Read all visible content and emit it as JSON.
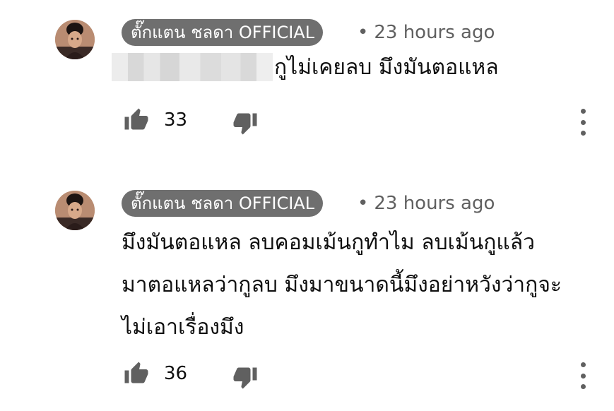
{
  "comments": [
    {
      "author": "ตั๊กแตน ชลดา OFFICIAL",
      "separator": "•",
      "time": "23 hours ago",
      "lines": [
        "กูไม่เคยลบ มึงมันตอแหล"
      ],
      "likes": "33",
      "has_redacted_mention": true
    },
    {
      "author": "ตั๊กแตน ชลดา OFFICIAL",
      "separator": "•",
      "time": "23 hours ago",
      "lines": [
        "มึงมันตอแหล ลบคอมเม้นกูทำไม ลบเม้นกูแล้ว",
        "มาตอแหลว่ากูลบ มึงมาขนาดนี้มึงอย่าหวังว่ากูจะ",
        "ไม่เอาเรื่องมึง"
      ],
      "likes": "36",
      "has_redacted_mention": false
    }
  ],
  "icons": {
    "like": "thumbs-up-icon",
    "dislike": "thumbs-down-icon",
    "menu": "more-vertical-icon"
  },
  "colors": {
    "author_pill": "#6f6f6f",
    "secondary_text": "#606060",
    "primary_text": "#0f0f0f",
    "icon": "#606060"
  }
}
